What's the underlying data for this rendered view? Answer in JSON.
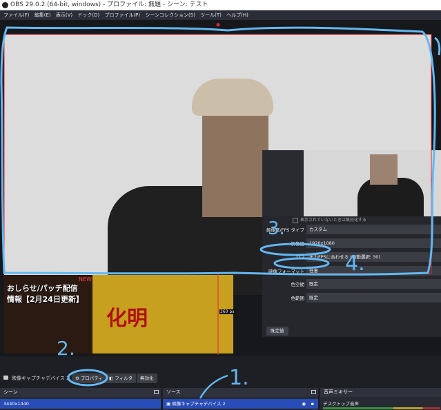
{
  "window": {
    "title": "OBS 29.0.2 (64-bit, windows) - プロファイル: 無題 - シーン: テスト"
  },
  "menu": [
    "ファイル(F)",
    "編集(E)",
    "表示(V)",
    "ドック(D)",
    "プロファイル(P)",
    "シーンコレクション(S)",
    "ツール(T)",
    "ヘルプ(H)"
  ],
  "preview": {
    "px_label": "360 px",
    "thumbnail": {
      "line1": "おしらせ/パッチ配信",
      "line2": "情報【2月24日更新】",
      "kanji": "化明",
      "new_tag": "NEW"
    }
  },
  "properties": {
    "hidden_checkbox": "表示されていないときは無効化する",
    "rows": [
      {
        "label": "解像度/FPS タイプ",
        "value": "カスタム"
      },
      {
        "label": "解像度",
        "value": "1920x1080"
      },
      {
        "label": "FPS",
        "value": "出力FPSに合わせる (自動選択: 30)"
      },
      {
        "label": "映像フォーマット",
        "value": "任意"
      },
      {
        "label": "色空間",
        "value": "既定"
      },
      {
        "label": "色範囲",
        "value": "既定"
      }
    ],
    "default_button": "既定値"
  },
  "source_bar": {
    "source_name": "映像キャプチャデバイス 2",
    "properties_button": "プロパティ",
    "filters_button": "フィルタ",
    "disable_button": "無効化"
  },
  "scenes": {
    "header": "シーン",
    "item": "3440x1440"
  },
  "sources": {
    "header": "ソース",
    "item": "映像キャプチャデバイス 2"
  },
  "mixer": {
    "header": "音声ミキサー",
    "channel": "デスクトップ音声"
  },
  "annotations": {
    "n1": "1.",
    "n2": "2.",
    "n3": "3.",
    "n4": "4."
  },
  "colors": {
    "annotation_blue": "#63b8f2",
    "selection_blue": "#284cb8",
    "bounding_red": "#e8262b"
  }
}
